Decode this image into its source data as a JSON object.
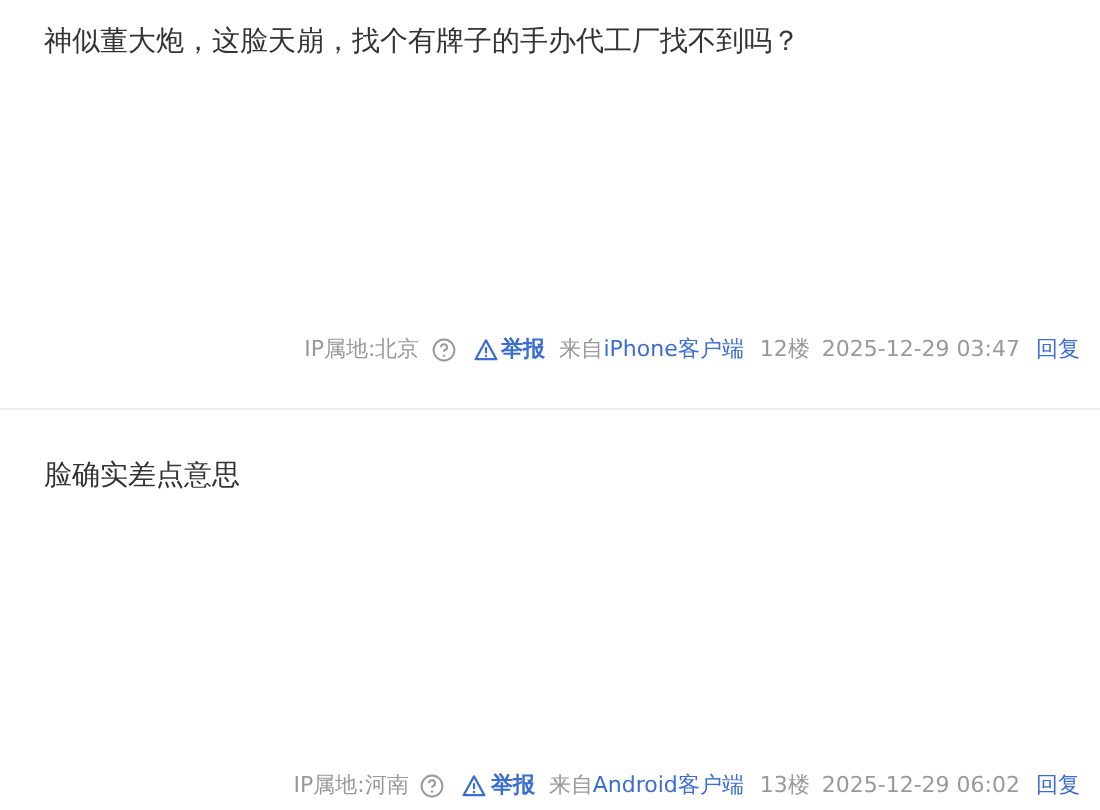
{
  "posts": [
    {
      "content": "神似董大炮，这脸天崩，找个有牌子的手办代工厂找不到吗？",
      "ip": "IP属地:北京",
      "report": "举报",
      "from_prefix": "来自",
      "client": "iPhone客户端",
      "floor": "12楼",
      "time": "2025-12-29 03:47",
      "reply": "回复"
    },
    {
      "content": "脸确实差点意思",
      "ip": "IP属地:河南",
      "report": "举报",
      "from_prefix": "来自",
      "client": "Android客户端",
      "floor": "13楼",
      "time": "2025-12-29 06:02",
      "reply": "回复"
    }
  ]
}
